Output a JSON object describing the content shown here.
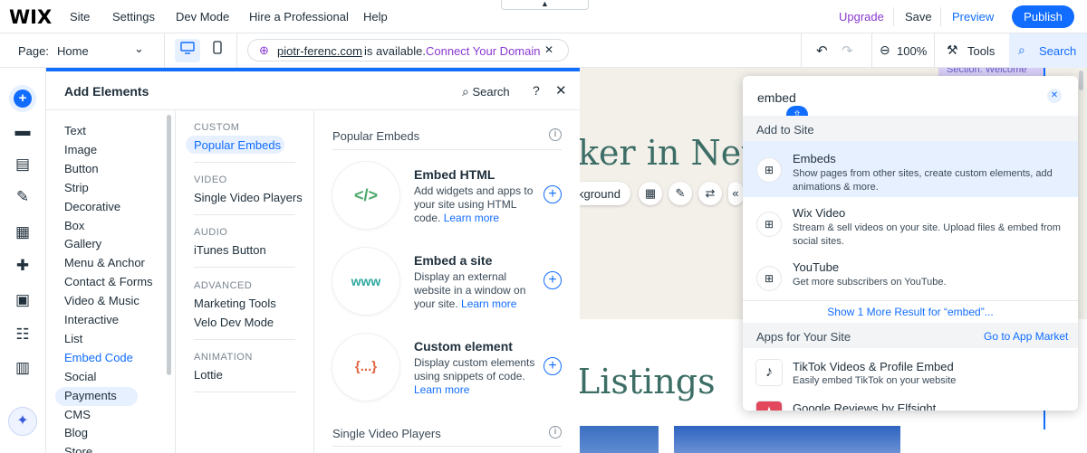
{
  "app": {
    "logo": "WIX"
  },
  "topmenu": {
    "items": [
      "Site",
      "Settings",
      "Dev Mode",
      "Hire a Professional",
      "Help"
    ],
    "upgrade": "Upgrade",
    "save": "Save",
    "preview": "Preview",
    "publish": "Publish"
  },
  "toolbar": {
    "page_label": "Page:",
    "page_name": "Home",
    "domain": "piotr-ferenc.com",
    "availability": "is available.",
    "connect": "Connect Your Domain",
    "zoom": "100%",
    "tools": "Tools",
    "search": "Search"
  },
  "add_panel": {
    "title": "Add Elements",
    "search_label": "Search",
    "categories": [
      "Text",
      "Image",
      "Button",
      "Strip",
      "Decorative",
      "Box",
      "Gallery",
      "Menu & Anchor",
      "Contact & Forms",
      "Video & Music",
      "Interactive",
      "List",
      "Embed Code",
      "Social",
      "Payments",
      "CMS",
      "Blog",
      "Store"
    ],
    "active_category": "Embed Code",
    "subcategories": [
      {
        "heading": "CUSTOM",
        "items": [
          "Popular Embeds"
        ]
      },
      {
        "heading": "VIDEO",
        "items": [
          "Single Video Players"
        ]
      },
      {
        "heading": "AUDIO",
        "items": [
          "iTunes Button"
        ]
      },
      {
        "heading": "ADVANCED",
        "items": [
          "Marketing Tools",
          "Velo Dev Mode"
        ]
      },
      {
        "heading": "ANIMATION",
        "items": [
          "Lottie"
        ]
      }
    ],
    "section_title": "Popular Embeds",
    "section_title_2": "Single Video Players",
    "embeds": [
      {
        "icon": "</>",
        "title": "Embed HTML",
        "desc": "Add widgets and apps to your site using HTML code.",
        "link": "Learn more"
      },
      {
        "icon": "www",
        "title": "Embed a site",
        "desc": "Display an external website in a window on your site.",
        "link": "Learn more"
      },
      {
        "icon": "{...}",
        "title": "Custom element",
        "desc": "Display custom elements using snippets of code.",
        "link": "Learn more"
      }
    ]
  },
  "canvas": {
    "hero_text": "ker in New",
    "background_btn": "kground",
    "listings": "Listings",
    "section_tag": "Section: Welcome"
  },
  "search_panel": {
    "query": "embed",
    "add_to_site": "Add to Site",
    "results": [
      {
        "title": "Embeds",
        "desc": "Show pages from other sites, create custom elements, add animations & more."
      },
      {
        "title": "Wix Video",
        "desc": "Stream & sell videos on your site. Upload files & embed from social sites."
      },
      {
        "title": "YouTube",
        "desc": "Get more subscribers on YouTube."
      }
    ],
    "more": "Show 1 More Result for “embed”...",
    "apps_header": "Apps for Your Site",
    "app_market": "Go to App Market",
    "apps": [
      {
        "title": "TikTok Videos & Profile Embed",
        "desc": "Easily embed TikTok on your website"
      },
      {
        "title": "Google Reviews by Elfsight",
        "desc": ""
      }
    ]
  },
  "colors": {
    "accent": "#116dff",
    "upgrade": "#8a3ad0",
    "heading_green": "#3d6e66"
  }
}
